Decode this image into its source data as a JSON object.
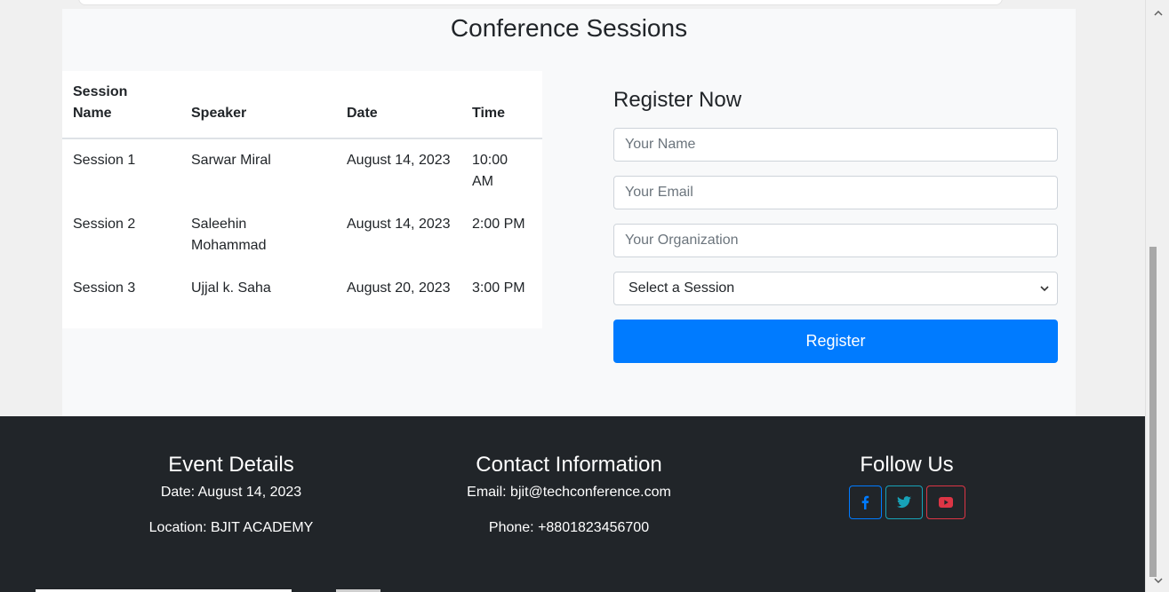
{
  "sessions": {
    "title": "Conference Sessions",
    "table": {
      "headers": [
        "Session Name",
        "Speaker",
        "Date",
        "Time"
      ],
      "rows": [
        [
          "Session 1",
          "Sarwar Miral",
          "August 14, 2023",
          "10:00 AM"
        ],
        [
          "Session 2",
          "Saleehin Mohammad",
          "August 14, 2023",
          "2:00 PM"
        ],
        [
          "Session 3",
          "Ujjal k. Saha",
          "August 20, 2023",
          "3:00 PM"
        ]
      ]
    }
  },
  "register": {
    "title": "Register Now",
    "name_placeholder": "Your Name",
    "email_placeholder": "Your Email",
    "org_placeholder": "Your Organization",
    "session_select_value": "Select a Session",
    "button_label": "Register"
  },
  "footer": {
    "event": {
      "title": "Event Details",
      "date": "Date: August 14, 2023",
      "location": "Location: BJIT ACADEMY"
    },
    "contact": {
      "title": "Contact Information",
      "email": "Email: bjit@techconference.com",
      "phone": "Phone: +8801823456700"
    },
    "follow": {
      "title": "Follow Us",
      "icons": [
        "facebook-icon",
        "twitter-icon",
        "youtube-icon"
      ],
      "colors": {
        "facebook": "#007bff",
        "twitter": "#17a2b8",
        "youtube": "#dc3545"
      }
    }
  },
  "colors": {
    "primary": "#007bff",
    "footer_bg": "#212529",
    "section_bg": "#f8f9fa"
  }
}
